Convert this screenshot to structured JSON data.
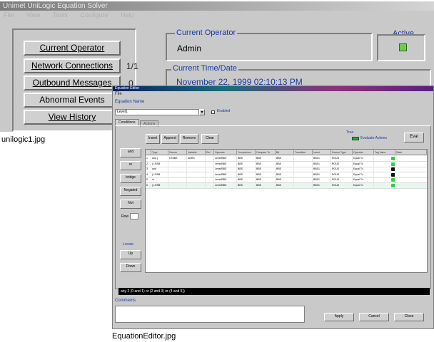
{
  "window1": {
    "title": "Unimet UniLogic Equation Solver",
    "menu": [
      "File",
      "View",
      "Tools",
      "Configure",
      "Help"
    ],
    "buttons": [
      {
        "label": "Current Operator",
        "side": ""
      },
      {
        "label": "Network Connections",
        "side": "1/1"
      },
      {
        "label": "Outbound Messages",
        "side": "0"
      },
      {
        "label": "Abnormal Events",
        "side": ""
      },
      {
        "label": "View History",
        "side": ""
      }
    ],
    "current_operator_label": "Current Operator",
    "current_operator_value": "Admin",
    "active_label": "Active",
    "current_time_label": "Current Time/Date",
    "current_time_value": "November 22, 1999   02:10:13 PM",
    "active_led_color": "#6ecb4e"
  },
  "captions": {
    "first": "unilogic1.jpg",
    "second": "EquationEditor.jpg"
  },
  "window2": {
    "title": "Equation Editor",
    "menu_file": "File",
    "equation_name_label": "Equation Name",
    "equation_name_value": "Level1",
    "enabled_label": "Enabled",
    "tabs": [
      "Conditions",
      "Actions"
    ],
    "toolbar": [
      "Insert",
      "Append",
      "Remove",
      "Clear"
    ],
    "true_value_label": "True",
    "true_value_text": "Evaluate Actions",
    "evaluate_label": "Eval",
    "left_buttons": [
      "and",
      "or",
      "bridge",
      "Negated",
      "Not"
    ],
    "row_label": "Row",
    "locate_label": "Locate",
    "locate_buttons": [
      "Up",
      "Down"
    ],
    "grid_headers": [
      "",
      "Type",
      "Source",
      "Variable",
      "Ref",
      "Operator",
      "Comparison",
      "Compare To",
      "Bit",
      "Transition",
      "Invert",
      "Source Type",
      "Operator",
      "Tag Value",
      "State"
    ],
    "grid_rows": [
      [
        "1",
        "and (",
        "LRSBS",
        "ANRS",
        "",
        "Level/BBS",
        "BBS",
        "BBS",
        "BBS",
        "",
        "BBS1",
        "ROUS",
        "Equal To",
        "on"
      ],
      [
        "2",
        "  ( LRSB",
        "",
        "",
        "",
        "Level/BBS",
        "BBS",
        "BBS",
        "BBS",
        "",
        "BBS1",
        "ROUS",
        "Equal To",
        "on"
      ],
      [
        "3",
        "and",
        "",
        "",
        "",
        "Level/BBS",
        "BBS",
        "BBS",
        "BBS",
        "",
        "BBS1",
        "ROUS",
        "Equal To",
        "off"
      ],
      [
        "4",
        "  ( LRSB",
        "",
        "",
        "",
        "Level/BBS",
        "BBS",
        "BBS",
        "BBS",
        "",
        "BBS1",
        "ROUS",
        "Equal To",
        "off"
      ],
      [
        "5",
        "or",
        "",
        "",
        "",
        "Level/BBS",
        "BBS",
        "BBS",
        "BBS",
        "",
        "BBS1",
        "ROUS",
        "Equal To",
        "on"
      ],
      [
        "6",
        "  ( LRSB",
        "",
        "",
        "",
        "Level/BBS",
        "BBS",
        "BBS",
        "BBS",
        "",
        "BBS1",
        "ROUS",
        "Equal To",
        "on"
      ]
    ],
    "expression": "any 2 (0 and 1) or (2 and 3) or (4 and 5))",
    "comments_label": "Comments",
    "bottom_buttons": [
      "Apply",
      "Cancel",
      "Close"
    ],
    "led_on_color": "#2fd04a",
    "led_off_color": "#101010"
  }
}
